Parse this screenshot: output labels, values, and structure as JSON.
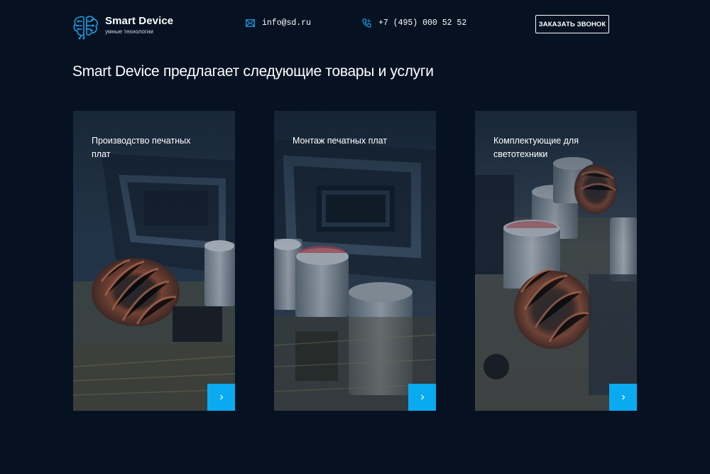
{
  "header": {
    "logo": {
      "title": "Smart Device",
      "subtitle": "умные технологии",
      "icon": "brain-circuit-icon",
      "color": "#1d9be3"
    },
    "email": {
      "icon": "mail-icon",
      "text": "info@sd.ru"
    },
    "phone": {
      "icon": "phone-icon",
      "text": "+7 (495) 000 52 52"
    },
    "call_button": "ЗАКАЗАТЬ ЗВОНОК"
  },
  "main": {
    "title": "Smart Device предлагает следующие товары и услуги",
    "cards": [
      {
        "title": "Производство печатных плат",
        "button_icon": "chevron-right-icon"
      },
      {
        "title": "Монтаж печатных плат",
        "button_icon": "chevron-right-icon"
      },
      {
        "title": "Комплектующие для светотехники",
        "button_icon": "chevron-right-icon"
      }
    ]
  },
  "colors": {
    "background": "#061221",
    "accent": "#0aaaf0",
    "text": "#ffffff"
  }
}
